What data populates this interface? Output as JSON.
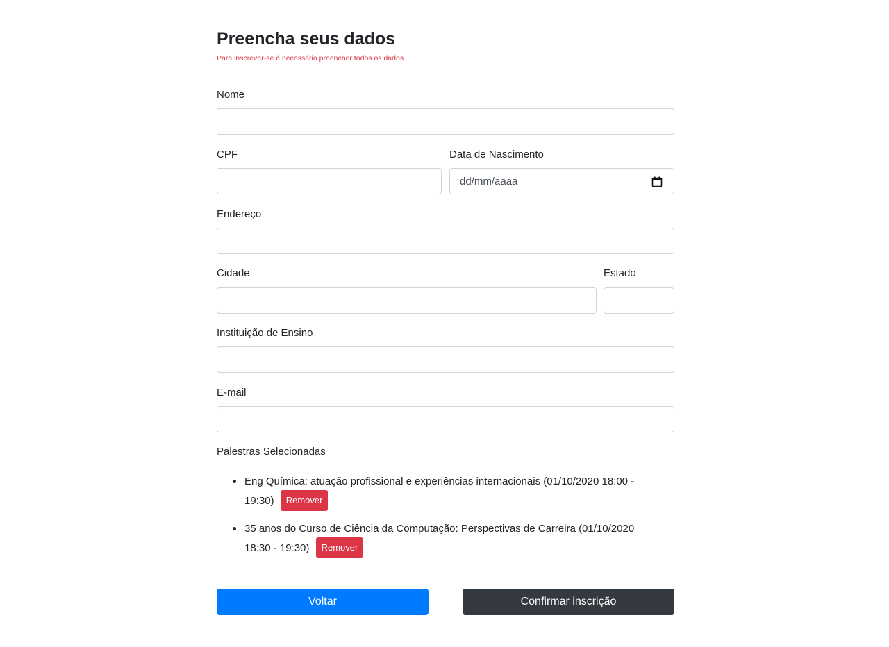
{
  "form": {
    "title": "Preencha seus dados",
    "subtitle": "Para inscrever-se é necessário preencher todos os dados.",
    "fields": {
      "nome": {
        "label": "Nome",
        "value": ""
      },
      "cpf": {
        "label": "CPF",
        "value": ""
      },
      "nascimento": {
        "label": "Data de Nascimento",
        "placeholder": "dd/mm/aaaa"
      },
      "endereco": {
        "label": "Endereço",
        "value": ""
      },
      "cidade": {
        "label": "Cidade",
        "value": ""
      },
      "estado": {
        "label": "Estado",
        "value": ""
      },
      "instituicao": {
        "label": "Instituição de Ensino",
        "value": ""
      },
      "email": {
        "label": "E-mail",
        "value": ""
      }
    },
    "selected_talks": {
      "label": "Palestras Selecionadas",
      "items": [
        {
          "text": "Eng Química: atuação profissional e experiências internacionais (01/10/2020 18:00 - 19:30)",
          "remove_label": "Remover"
        },
        {
          "text": "35 anos do Curso de Ciência da Computação: Perspectivas de Carreira (01/10/2020 18:30 - 19:30)",
          "remove_label": "Remover"
        }
      ]
    },
    "buttons": {
      "back_label": "Voltar",
      "confirm_label": "Confirmar inscrição"
    }
  },
  "icons": {
    "date_picker": "calendar-icon"
  },
  "colors": {
    "subtitle": "#dc3545",
    "remove_button": "#dc3545",
    "back_button": "#007bff",
    "confirm_button": "#343a40",
    "input_border": "#ced4da"
  }
}
